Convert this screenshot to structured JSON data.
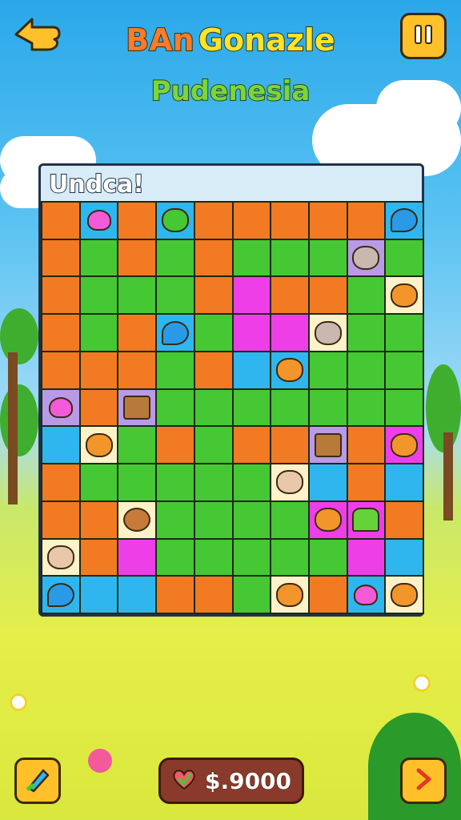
{
  "header": {
    "title_part1": "BAn",
    "title_part2": "Gonazle",
    "subtitle": "Pudenesia"
  },
  "panel": {
    "label": "Undca!"
  },
  "board": {
    "rows": [
      [
        {
          "c": "o",
          "p": ""
        },
        {
          "c": "b",
          "p": "heart"
        },
        {
          "c": "o",
          "p": ""
        },
        {
          "c": "b",
          "p": "frog"
        },
        {
          "c": "o",
          "p": ""
        },
        {
          "c": "o",
          "p": ""
        },
        {
          "c": "o",
          "p": ""
        },
        {
          "c": "o",
          "p": ""
        },
        {
          "c": "o",
          "p": ""
        },
        {
          "c": "b",
          "p": "drop"
        }
      ],
      [
        {
          "c": "o",
          "p": ""
        },
        {
          "c": "g",
          "p": ""
        },
        {
          "c": "o",
          "p": ""
        },
        {
          "c": "g",
          "p": ""
        },
        {
          "c": "o",
          "p": ""
        },
        {
          "c": "g",
          "p": ""
        },
        {
          "c": "g",
          "p": ""
        },
        {
          "c": "g",
          "p": ""
        },
        {
          "c": "l",
          "p": "mouse"
        },
        {
          "c": "g",
          "p": ""
        }
      ],
      [
        {
          "c": "o",
          "p": ""
        },
        {
          "c": "g",
          "p": ""
        },
        {
          "c": "g",
          "p": ""
        },
        {
          "c": "g",
          "p": ""
        },
        {
          "c": "o",
          "p": ""
        },
        {
          "c": "m",
          "p": ""
        },
        {
          "c": "o",
          "p": ""
        },
        {
          "c": "o",
          "p": ""
        },
        {
          "c": "g",
          "p": ""
        },
        {
          "c": "c",
          "p": "bear"
        }
      ],
      [
        {
          "c": "o",
          "p": ""
        },
        {
          "c": "g",
          "p": ""
        },
        {
          "c": "o",
          "p": ""
        },
        {
          "c": "b",
          "p": "drop"
        },
        {
          "c": "g",
          "p": ""
        },
        {
          "c": "m",
          "p": ""
        },
        {
          "c": "m",
          "p": ""
        },
        {
          "c": "c",
          "p": "mouse"
        },
        {
          "c": "g",
          "p": ""
        },
        {
          "c": "g",
          "p": ""
        }
      ],
      [
        {
          "c": "o",
          "p": ""
        },
        {
          "c": "o",
          "p": ""
        },
        {
          "c": "o",
          "p": ""
        },
        {
          "c": "g",
          "p": ""
        },
        {
          "c": "o",
          "p": ""
        },
        {
          "c": "b",
          "p": ""
        },
        {
          "c": "b",
          "p": "bear"
        },
        {
          "c": "g",
          "p": ""
        },
        {
          "c": "g",
          "p": ""
        },
        {
          "c": "g",
          "p": ""
        }
      ],
      [
        {
          "c": "l",
          "p": "heart"
        },
        {
          "c": "o",
          "p": ""
        },
        {
          "c": "l",
          "p": "box"
        },
        {
          "c": "g",
          "p": ""
        },
        {
          "c": "g",
          "p": ""
        },
        {
          "c": "g",
          "p": ""
        },
        {
          "c": "g",
          "p": ""
        },
        {
          "c": "g",
          "p": ""
        },
        {
          "c": "g",
          "p": ""
        },
        {
          "c": "g",
          "p": ""
        }
      ],
      [
        {
          "c": "b",
          "p": ""
        },
        {
          "c": "c",
          "p": "bear"
        },
        {
          "c": "g",
          "p": ""
        },
        {
          "c": "o",
          "p": ""
        },
        {
          "c": "g",
          "p": ""
        },
        {
          "c": "o",
          "p": ""
        },
        {
          "c": "o",
          "p": ""
        },
        {
          "c": "l",
          "p": "box"
        },
        {
          "c": "o",
          "p": ""
        },
        {
          "c": "m",
          "p": "bear"
        }
      ],
      [
        {
          "c": "o",
          "p": ""
        },
        {
          "c": "g",
          "p": ""
        },
        {
          "c": "g",
          "p": ""
        },
        {
          "c": "g",
          "p": ""
        },
        {
          "c": "g",
          "p": ""
        },
        {
          "c": "g",
          "p": ""
        },
        {
          "c": "c",
          "p": "pig"
        },
        {
          "c": "b",
          "p": ""
        },
        {
          "c": "o",
          "p": ""
        },
        {
          "c": "b",
          "p": ""
        }
      ],
      [
        {
          "c": "o",
          "p": ""
        },
        {
          "c": "o",
          "p": ""
        },
        {
          "c": "c",
          "p": "bread"
        },
        {
          "c": "g",
          "p": ""
        },
        {
          "c": "g",
          "p": ""
        },
        {
          "c": "g",
          "p": ""
        },
        {
          "c": "g",
          "p": ""
        },
        {
          "c": "m",
          "p": "bear"
        },
        {
          "c": "m",
          "p": "cactus"
        },
        {
          "c": "o",
          "p": ""
        }
      ],
      [
        {
          "c": "c",
          "p": "pig"
        },
        {
          "c": "o",
          "p": ""
        },
        {
          "c": "m",
          "p": ""
        },
        {
          "c": "g",
          "p": ""
        },
        {
          "c": "g",
          "p": ""
        },
        {
          "c": "g",
          "p": ""
        },
        {
          "c": "g",
          "p": ""
        },
        {
          "c": "g",
          "p": ""
        },
        {
          "c": "m",
          "p": ""
        },
        {
          "c": "b",
          "p": ""
        }
      ],
      [
        {
          "c": "b",
          "p": "drop"
        },
        {
          "c": "b",
          "p": ""
        },
        {
          "c": "b",
          "p": ""
        },
        {
          "c": "o",
          "p": ""
        },
        {
          "c": "o",
          "p": ""
        },
        {
          "c": "g",
          "p": ""
        },
        {
          "c": "c",
          "p": "bear"
        },
        {
          "c": "o",
          "p": ""
        },
        {
          "c": "b",
          "p": "heart"
        },
        {
          "c": "c",
          "p": "bear"
        }
      ]
    ]
  },
  "footer": {
    "coins": "$.9000"
  },
  "icons": {
    "back": "pointing-hand-icon",
    "pause": "pause-icon",
    "tools": "pencil-icon",
    "next": "chevron-right-icon",
    "coin": "heart-check-icon"
  },
  "colors": {
    "orange": "#f27a22",
    "green": "#46c834",
    "magenta": "#ee3ee8",
    "blue": "#2fb6ee",
    "lavender": "#b89ae6",
    "cream": "#fff1c8",
    "button_yellow": "#ffc02a"
  }
}
